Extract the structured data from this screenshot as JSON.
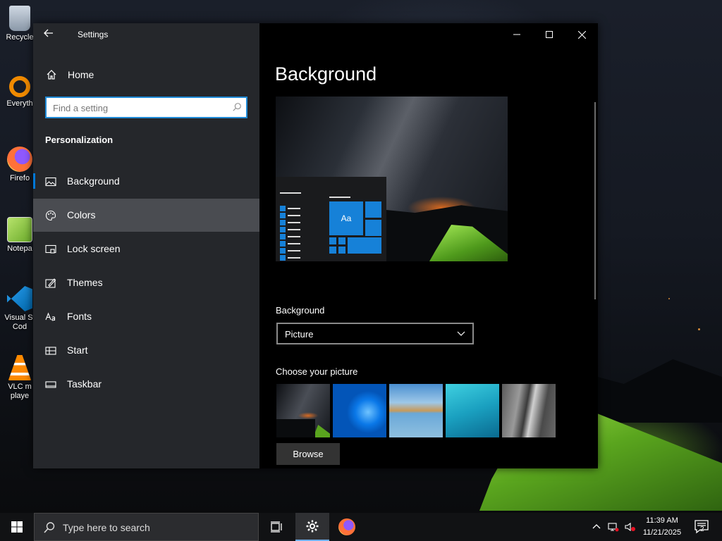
{
  "desktop": {
    "icons": [
      {
        "label": "Recycle"
      },
      {
        "label": "Everyth"
      },
      {
        "label": "Firefo"
      },
      {
        "label": "Notepa"
      },
      {
        "label": "Visual St\nCod"
      },
      {
        "label": "VLC m\nplaye"
      }
    ]
  },
  "settings": {
    "title": "Settings",
    "home_label": "Home",
    "search_placeholder": "Find a setting",
    "section_heading": "Personalization",
    "nav_items": [
      {
        "label": "Background",
        "icon": "picture-icon"
      },
      {
        "label": "Colors",
        "icon": "palette-icon"
      },
      {
        "label": "Lock screen",
        "icon": "lock-screen-icon"
      },
      {
        "label": "Themes",
        "icon": "themes-icon"
      },
      {
        "label": "Fonts",
        "icon": "fonts-icon"
      },
      {
        "label": "Start",
        "icon": "start-icon"
      },
      {
        "label": "Taskbar",
        "icon": "taskbar-icon"
      }
    ],
    "selected_item": "Colors",
    "active_item": "Background"
  },
  "content": {
    "page_title": "Background",
    "preview_tile_text": "Aa",
    "background_label": "Background",
    "background_value": "Picture",
    "choose_label": "Choose your picture",
    "browse_label": "Browse"
  },
  "taskbar": {
    "search_placeholder": "Type here to search",
    "time": "11:39 AM",
    "date": "11/21/2025",
    "notification_count": "2"
  },
  "colors": {
    "accent": "#0078d7",
    "nav_bg": "#2a2c30",
    "selected_bg": "#4a4c51"
  }
}
